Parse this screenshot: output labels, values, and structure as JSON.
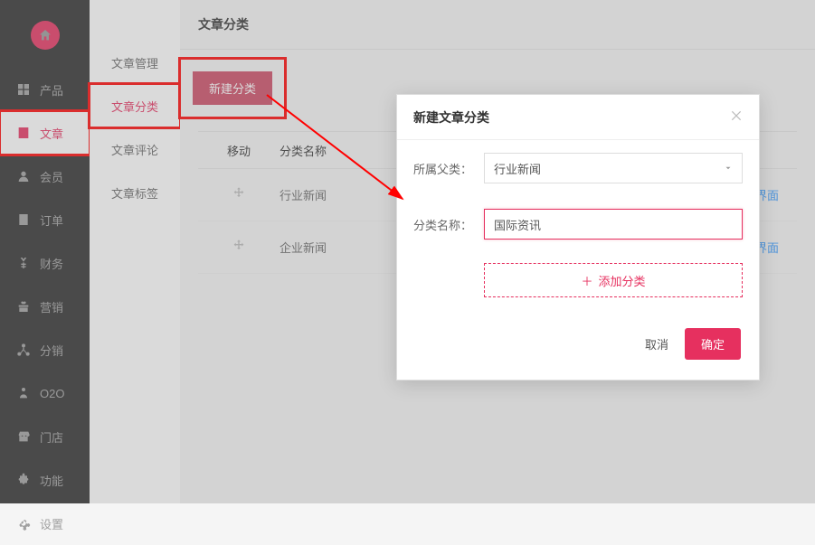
{
  "sidebar": {
    "items": [
      {
        "label": "产品",
        "icon": "grid-icon"
      },
      {
        "label": "文章",
        "icon": "document-icon",
        "active": true
      },
      {
        "label": "会员",
        "icon": "user-icon"
      },
      {
        "label": "订单",
        "icon": "order-icon"
      },
      {
        "label": "财务",
        "icon": "yen-icon"
      },
      {
        "label": "营销",
        "icon": "gift-icon"
      },
      {
        "label": "分销",
        "icon": "network-icon"
      },
      {
        "label": "O2O",
        "icon": "o2o-icon"
      },
      {
        "label": "门店",
        "icon": "store-icon"
      },
      {
        "label": "功能",
        "icon": "puzzle-icon"
      },
      {
        "label": "设置",
        "icon": "gear-icon"
      }
    ]
  },
  "subnav": {
    "items": [
      {
        "label": "文章管理"
      },
      {
        "label": "文章分类",
        "active": true
      },
      {
        "label": "文章评论"
      },
      {
        "label": "文章标签"
      }
    ]
  },
  "page": {
    "title": "文章分类",
    "new_button": "新建分类"
  },
  "table": {
    "headers": {
      "move": "移动",
      "name": "分类名称"
    },
    "rows": [
      {
        "name": "行业新闻",
        "op_text": "立界面"
      },
      {
        "name": "企业新闻",
        "op_text": "立界面"
      }
    ]
  },
  "modal": {
    "title": "新建文章分类",
    "parent_label": "所属父类：",
    "parent_value": "行业新闻",
    "name_label": "分类名称：",
    "name_value": "国际资讯",
    "add_more": "添加分类",
    "cancel": "取消",
    "ok": "确定"
  }
}
